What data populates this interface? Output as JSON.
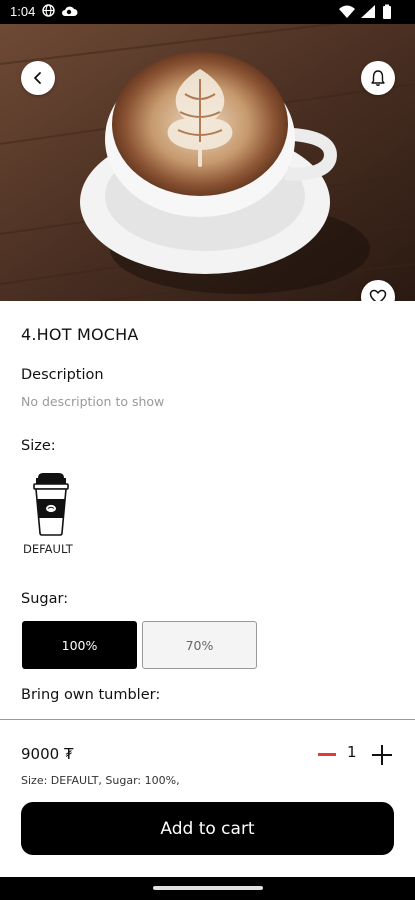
{
  "status_bar": {
    "time": "1:04"
  },
  "product": {
    "title": "4.HOT MOCHA",
    "description_label": "Description",
    "description_text": "No description to show"
  },
  "size": {
    "label": "Size:",
    "options": [
      {
        "label": "DEFAULT",
        "icon": "coffee-cup-icon",
        "selected": true
      }
    ]
  },
  "sugar": {
    "label": "Sugar:",
    "options": [
      {
        "label": "100%",
        "selected": true
      },
      {
        "label": "70%",
        "selected": false
      }
    ]
  },
  "tumbler": {
    "label": "Bring own tumbler:"
  },
  "cart": {
    "price": "9000 ₮",
    "quantity": "1",
    "summary": "Size: DEFAULT, Sugar: 100%,",
    "button_label": "Add to cart"
  },
  "colors": {
    "accent": "#000000",
    "minus": "#e53935",
    "background": "#ffffff"
  },
  "icons": [
    "back-arrow-icon",
    "bell-icon",
    "heart-icon",
    "coffee-cup-icon",
    "minus-icon",
    "plus-icon"
  ]
}
